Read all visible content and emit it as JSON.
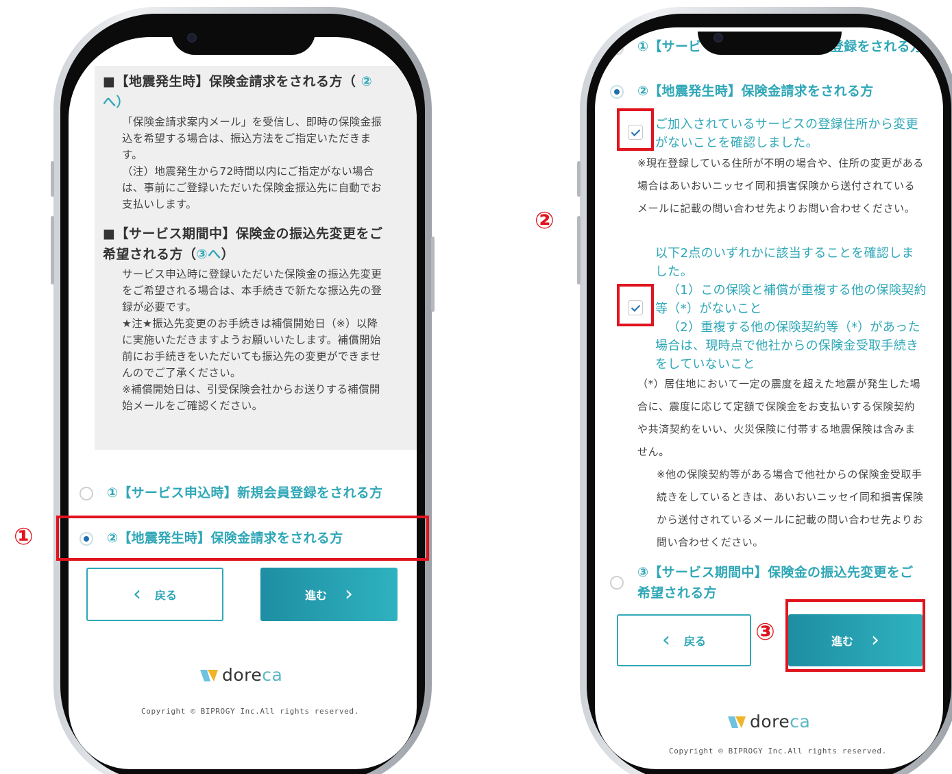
{
  "left": {
    "heading1": "■【地震発生時】保険金請求をされる方（",
    "heading1_ref": "②へ）",
    "body1": "「保険金請求案内メール」を受信し、即時の保険金振込を希望する場合は、振込方法をご指定いただきます。\n（注）地震発生から72時間以内にご指定がない場合は、事前にご登録いただいた保険金振込先に自動でお支払いします。",
    "heading2": "■【サービス期間中】保険金の振込先変更をご希望される方（",
    "heading2_ref": "③へ",
    "heading2_close": "）",
    "body2": "サービス申込時に登録いただいた保険金の振込先変更をご希望される場合は、本手続きで新たな振込先の登録が必要です。\n★注★振込先変更のお手続きは補償開始日（※）以降に実施いただきますようお願いいたします。補償開始前にお手続きをいただいても振込先の変更ができませんのでご了承ください。\n※補償開始日は、引受保険会社からお送りする補償開始メールをご確認ください。",
    "option1": "①【サービス申込時】新規会員登録をされる方",
    "option2": "②【地震発生時】保険金請求をされる方",
    "back_label": "戻る",
    "next_label": "進む",
    "marker": "①"
  },
  "right": {
    "option1_partial_left": "①【サービ",
    "option1_partial_right": "登録をされる方",
    "option2": "②【地震発生時】保険金請求をされる方",
    "check1_label": "ご加入されているサービスの登録住所から変更がないことを確認しました。",
    "note1": "※現在登録している住所が不明の場合や、住所の変更がある場合はあいおいニッセイ同和損害保険から送付されているメールに記載の問い合わせ先よりお問い合わせください。",
    "confirm_intro": "以下2点のいずれかに該当することを確認しました。",
    "check2_item1": "（1）この保険と補償が重複する他の保険契約等（*）がないこと",
    "check2_item2": "（2）重複する他の保険契約等（*）があった場合は、現時点で他社からの保険金受取手続きをしていないこと",
    "note2": "（*）居住地において一定の震度を超えた地震が発生した場合に、震度に応じて定額で保険金をお支払いする保険契約や共済契約をいい、火災保険に付帯する地震保険は含みません。",
    "note3": "※他の保険契約等がある場合で他社からの保険金受取手続きをしているときは、あいおいニッセイ同和損害保険から送付されているメールに記載の問い合わせ先よりお問い合わせください。",
    "option3": "③【サービス期間中】保険金の振込先変更をご希望される方",
    "back_label": "戻る",
    "next_label": "進む",
    "marker2": "②",
    "marker3": "③"
  },
  "footer": {
    "logo_main": "dore",
    "logo_accent": "ca",
    "copyright": "Copyright © BIPROGY Inc.All rights reserved."
  },
  "colors": {
    "accent": "#2fa7b7",
    "highlight": "#e0141e"
  }
}
